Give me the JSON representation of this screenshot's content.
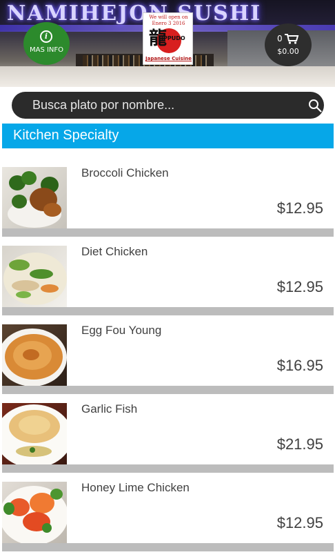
{
  "header": {
    "sign_text": "NAMIHEJON SUSHI",
    "info_button_label": "MAS INFO",
    "logo": {
      "announcement_line1": "We will open on",
      "announcement_line2": "Enero 3 2016",
      "kanji": "龍",
      "brand": "IPPUDO",
      "subtitle": "Japanese Cuisine"
    },
    "cart": {
      "count": "0",
      "total": "$0.00",
      "icon": "cart-icon"
    }
  },
  "search": {
    "placeholder": "Busca plato por nombre...",
    "value": "",
    "icon": "search-icon"
  },
  "category": {
    "title": "Kitchen Specialty",
    "color": "#06a7e8"
  },
  "items": [
    {
      "name": "Broccoli Chicken",
      "price": "$12.95"
    },
    {
      "name": "Diet Chicken",
      "price": "$12.95"
    },
    {
      "name": "Egg Fou Young",
      "price": "$16.95"
    },
    {
      "name": "Garlic Fish",
      "price": "$21.95"
    },
    {
      "name": "Honey Lime Chicken",
      "price": "$12.95"
    }
  ],
  "colors": {
    "info_button": "#2c8a2c",
    "cart_button": "#2e2e2e",
    "search_bar": "#2b2b2b",
    "divider": "#bcbcbc"
  }
}
